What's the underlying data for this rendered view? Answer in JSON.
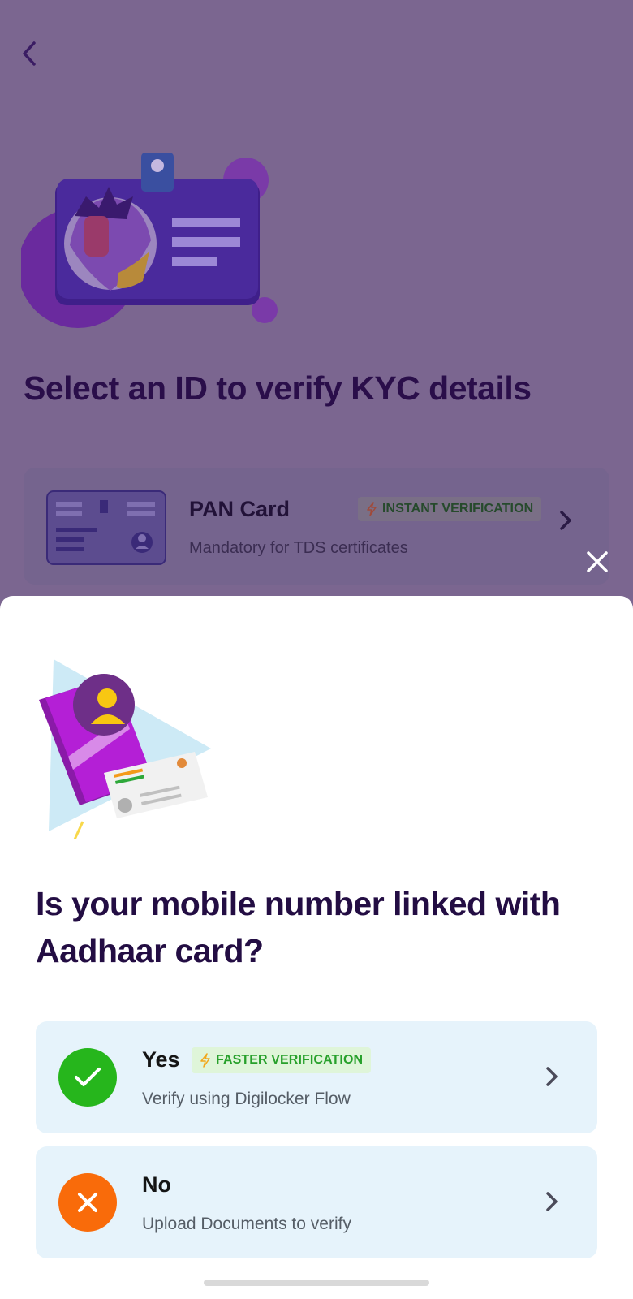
{
  "colors": {
    "page_overlay": "#7b6690",
    "title_dark": "#230d43",
    "accent_purple": "#6a1fd0",
    "option_bg": "#e6f3fb",
    "yes_green": "#26b61c",
    "no_orange": "#f96b0a",
    "badge_green": "#27a02b"
  },
  "header": {
    "back_icon": "chevron-left-icon"
  },
  "page": {
    "title": "Select an ID to verify KYC details",
    "pan_option": {
      "title": "PAN Card",
      "badge": "INSTANT VERIFICATION",
      "subtitle": "Mandatory for TDS certificates"
    }
  },
  "sheet": {
    "close_icon": "close-icon",
    "title": "Is your mobile number linked with Aadhaar card?",
    "options": [
      {
        "title": "Yes",
        "badge": "FASTER VERIFICATION",
        "subtitle": "Verify using Digilocker Flow",
        "icon": "check-icon"
      },
      {
        "title": "No",
        "subtitle": "Upload Documents to verify",
        "icon": "cross-icon"
      }
    ]
  }
}
